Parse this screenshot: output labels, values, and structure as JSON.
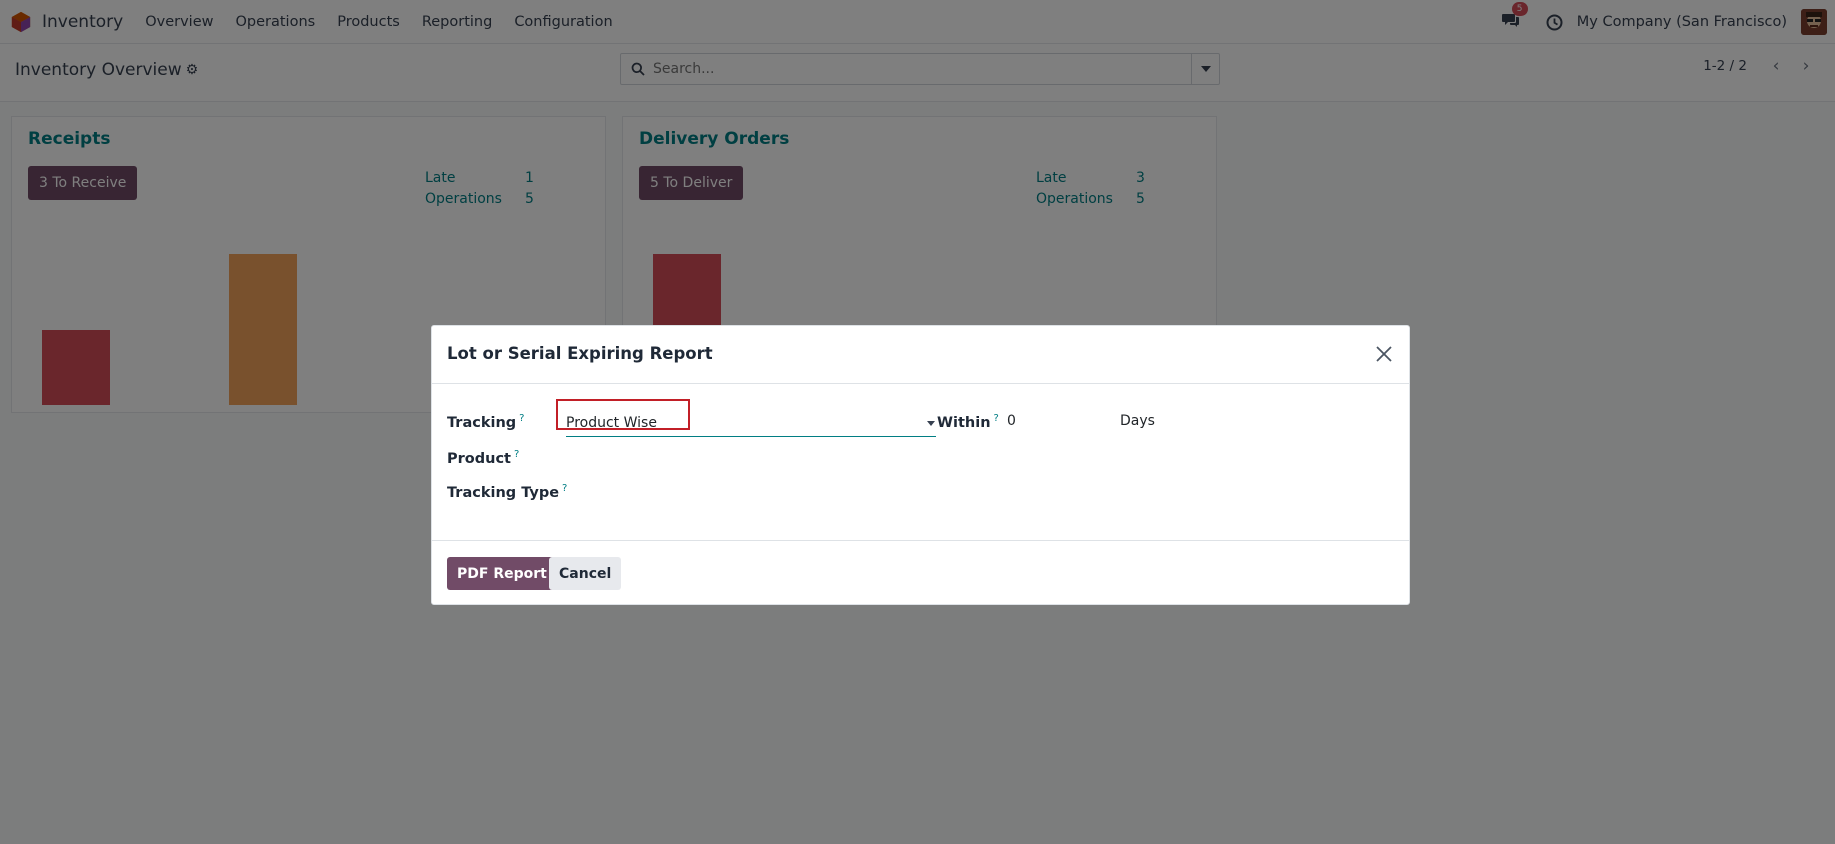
{
  "navbar": {
    "brand": "Inventory",
    "menu": [
      "Overview",
      "Operations",
      "Products",
      "Reporting",
      "Configuration"
    ],
    "chat_count": "5",
    "company": "My Company (San Francisco)"
  },
  "control": {
    "title": "Inventory Overview",
    "search_placeholder": "Search...",
    "pager": "1-2 / 2"
  },
  "cards": [
    {
      "title": "Receipts",
      "button": "3 To Receive",
      "stats": [
        {
          "label": "Late",
          "value": "1"
        },
        {
          "label": "Operations",
          "value": "5"
        }
      ]
    },
    {
      "title": "Delivery Orders",
      "button": "5 To Deliver",
      "stats": [
        {
          "label": "Late",
          "value": "3"
        },
        {
          "label": "Operations",
          "value": "5"
        }
      ]
    }
  ],
  "colors": {
    "primary": "#714b67",
    "teal": "#017e84",
    "bar_red": "#d44c59",
    "bar_orange": "#f3a25a",
    "highlight": "#c21f27"
  },
  "modal": {
    "title": "Lot or Serial Expiring Report",
    "fields": {
      "tracking_label": "Tracking",
      "tracking_value": "Product Wise",
      "within_label": "Within",
      "within_value": "0",
      "within_unit": "Days",
      "product_label": "Product",
      "tracking_type_label": "Tracking Type",
      "help_marker": "?"
    },
    "buttons": {
      "primary": "PDF Report",
      "secondary": "Cancel"
    }
  }
}
